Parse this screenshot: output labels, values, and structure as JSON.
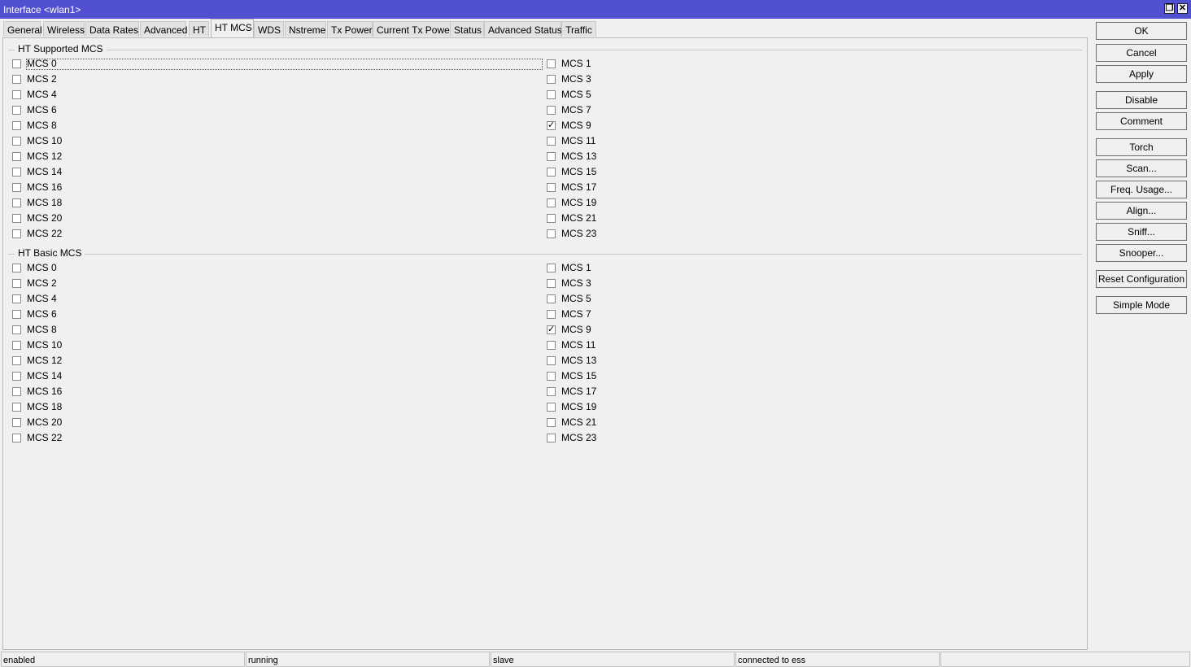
{
  "window": {
    "title": "Interface <wlan1>",
    "restore_glyph": "❐",
    "close_glyph": "✕",
    "title_bar_color": "#5050d0"
  },
  "tabs": [
    {
      "label": "General"
    },
    {
      "label": "Wireless"
    },
    {
      "label": "Data Rates"
    },
    {
      "label": "Advanced"
    },
    {
      "label": "HT"
    },
    {
      "label": "HT MCS",
      "active": true
    },
    {
      "label": "WDS"
    },
    {
      "label": "Nstreme"
    },
    {
      "label": "Tx Power"
    },
    {
      "label": "Current Tx Power"
    },
    {
      "label": "Status"
    },
    {
      "label": "Advanced Status"
    },
    {
      "label": "Traffic"
    }
  ],
  "groups": {
    "supported": {
      "title": "HT Supported MCS",
      "items": [
        {
          "label": "MCS 0",
          "checked": false
        },
        {
          "label": "MCS 1",
          "checked": false
        },
        {
          "label": "MCS 2",
          "checked": false
        },
        {
          "label": "MCS 3",
          "checked": false
        },
        {
          "label": "MCS 4",
          "checked": false
        },
        {
          "label": "MCS 5",
          "checked": false
        },
        {
          "label": "MCS 6",
          "checked": false
        },
        {
          "label": "MCS 7",
          "checked": false
        },
        {
          "label": "MCS 8",
          "checked": false
        },
        {
          "label": "MCS 9",
          "checked": true
        },
        {
          "label": "MCS 10",
          "checked": false
        },
        {
          "label": "MCS 11",
          "checked": false
        },
        {
          "label": "MCS 12",
          "checked": false
        },
        {
          "label": "MCS 13",
          "checked": false
        },
        {
          "label": "MCS 14",
          "checked": false
        },
        {
          "label": "MCS 15",
          "checked": false
        },
        {
          "label": "MCS 16",
          "checked": false
        },
        {
          "label": "MCS 17",
          "checked": false
        },
        {
          "label": "MCS 18",
          "checked": false
        },
        {
          "label": "MCS 19",
          "checked": false
        },
        {
          "label": "MCS 20",
          "checked": false
        },
        {
          "label": "MCS 21",
          "checked": false
        },
        {
          "label": "MCS 22",
          "checked": false
        },
        {
          "label": "MCS 23",
          "checked": false
        }
      ]
    },
    "basic": {
      "title": "HT Basic MCS",
      "items": [
        {
          "label": "MCS 0",
          "checked": false
        },
        {
          "label": "MCS 1",
          "checked": false
        },
        {
          "label": "MCS 2",
          "checked": false
        },
        {
          "label": "MCS 3",
          "checked": false
        },
        {
          "label": "MCS 4",
          "checked": false
        },
        {
          "label": "MCS 5",
          "checked": false
        },
        {
          "label": "MCS 6",
          "checked": false
        },
        {
          "label": "MCS 7",
          "checked": false
        },
        {
          "label": "MCS 8",
          "checked": false
        },
        {
          "label": "MCS 9",
          "checked": true
        },
        {
          "label": "MCS 10",
          "checked": false
        },
        {
          "label": "MCS 11",
          "checked": false
        },
        {
          "label": "MCS 12",
          "checked": false
        },
        {
          "label": "MCS 13",
          "checked": false
        },
        {
          "label": "MCS 14",
          "checked": false
        },
        {
          "label": "MCS 15",
          "checked": false
        },
        {
          "label": "MCS 16",
          "checked": false
        },
        {
          "label": "MCS 17",
          "checked": false
        },
        {
          "label": "MCS 18",
          "checked": false
        },
        {
          "label": "MCS 19",
          "checked": false
        },
        {
          "label": "MCS 20",
          "checked": false
        },
        {
          "label": "MCS 21",
          "checked": false
        },
        {
          "label": "MCS 22",
          "checked": false
        },
        {
          "label": "MCS 23",
          "checked": false
        }
      ]
    }
  },
  "checkmark_glyph": "✓",
  "buttons": [
    {
      "label": "OK",
      "name": "ok-button"
    },
    {
      "label": "Cancel",
      "name": "cancel-button"
    },
    {
      "label": "Apply",
      "name": "apply-button"
    },
    {
      "label": "Disable",
      "name": "disable-button"
    },
    {
      "label": "Comment",
      "name": "comment-button"
    },
    {
      "label": "Torch",
      "name": "torch-button"
    },
    {
      "label": "Scan...",
      "name": "scan-button"
    },
    {
      "label": "Freq. Usage...",
      "name": "freq-usage-button"
    },
    {
      "label": "Align...",
      "name": "align-button"
    },
    {
      "label": "Sniff...",
      "name": "sniff-button"
    },
    {
      "label": "Snooper...",
      "name": "snooper-button"
    },
    {
      "label": "Reset Configuration",
      "name": "reset-configuration-button"
    },
    {
      "label": "Simple Mode",
      "name": "simple-mode-button"
    }
  ],
  "status": [
    "enabled",
    "running",
    "slave",
    "connected to ess",
    ""
  ]
}
